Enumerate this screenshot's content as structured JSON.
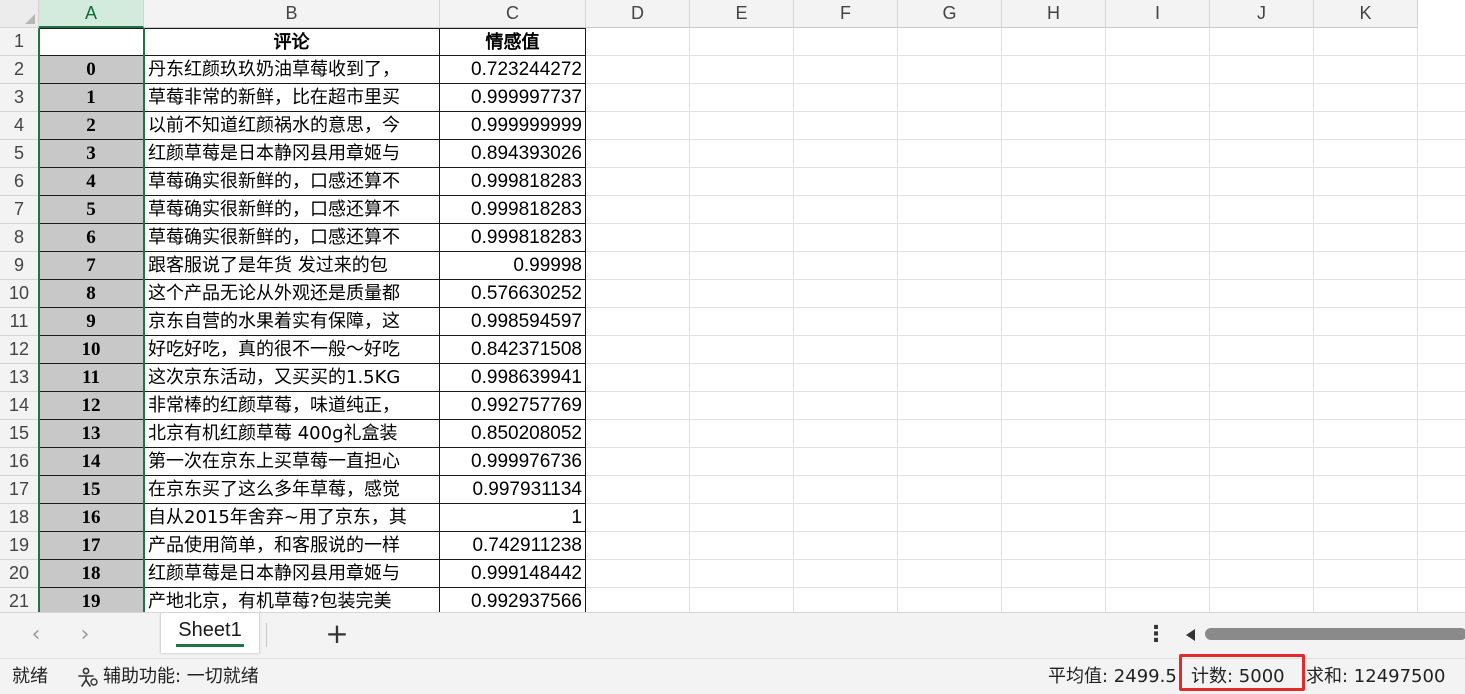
{
  "columns": [
    "A",
    "B",
    "C",
    "D",
    "E",
    "F",
    "G",
    "H",
    "I",
    "J",
    "K"
  ],
  "header_row": {
    "a": "",
    "b": "评论",
    "c": "情感值"
  },
  "rows": [
    {
      "num": "1"
    },
    {
      "num": "2",
      "a": "0",
      "b": "丹东红颜玖玖奶油草莓收到了，",
      "c": "0.723244272"
    },
    {
      "num": "3",
      "a": "1",
      "b": "草莓非常的新鲜，比在超市里买",
      "c": "0.999997737"
    },
    {
      "num": "4",
      "a": "2",
      "b": "以前不知道红颜祸水的意思，今",
      "c": "0.999999999"
    },
    {
      "num": "5",
      "a": "3",
      "b": "红颜草莓是日本静冈县用章姬与",
      "c": "0.894393026"
    },
    {
      "num": "6",
      "a": "4",
      "b": "草莓确实很新鲜的，口感还算不",
      "c": "0.999818283"
    },
    {
      "num": "7",
      "a": "5",
      "b": "草莓确实很新鲜的，口感还算不",
      "c": "0.999818283"
    },
    {
      "num": "8",
      "a": "6",
      "b": "草莓确实很新鲜的，口感还算不",
      "c": "0.999818283"
    },
    {
      "num": "9",
      "a": "7",
      "b": "跟客服说了是年货 发过来的包",
      "c": "0.99998"
    },
    {
      "num": "10",
      "a": "8",
      "b": "这个产品无论从外观还是质量都",
      "c": "0.576630252"
    },
    {
      "num": "11",
      "a": "9",
      "b": "京东自营的水果着实有保障，这",
      "c": "0.998594597"
    },
    {
      "num": "12",
      "a": "10",
      "b": "好吃好吃，真的很不一般～好吃",
      "c": "0.842371508"
    },
    {
      "num": "13",
      "a": "11",
      "b": "这次京东活动，又买买的1.5KG",
      "c": "0.998639941"
    },
    {
      "num": "14",
      "a": "12",
      "b": "非常棒的红颜草莓，味道纯正，",
      "c": "0.992757769"
    },
    {
      "num": "15",
      "a": "13",
      "b": "北京有机红颜草莓 400g礼盒装",
      "c": "0.850208052"
    },
    {
      "num": "16",
      "a": "14",
      "b": "第一次在京东上买草莓一直担心",
      "c": "0.999976736"
    },
    {
      "num": "17",
      "a": "15",
      "b": "在京东买了这么多年草莓，感觉",
      "c": "0.997931134"
    },
    {
      "num": "18",
      "a": "16",
      "b": "自从2015年舍弃~用了京东，其",
      "c": "1"
    },
    {
      "num": "19",
      "a": "17",
      "b": "产品使用简单，和客服说的一样",
      "c": "0.742911238"
    },
    {
      "num": "20",
      "a": "18",
      "b": "红颜草莓是日本静冈县用章姬与",
      "c": "0.999148442"
    },
    {
      "num": "21",
      "a": "19",
      "b": "产地北京，有机草莓?包装完美",
      "c": "0.992937566"
    }
  ],
  "tabs": {
    "nav_prev": "‹",
    "nav_next": "›",
    "sheet_name": "Sheet1",
    "add_label": "+",
    "more_label": "⋮"
  },
  "status": {
    "ready": "就绪",
    "accessibility": "辅助功能: 一切就绪",
    "average": "平均值: 2499.5",
    "count": "计数: 5000",
    "sum": "求和: 12497500"
  },
  "colors": {
    "accent": "#217346",
    "highlight_box": "#e12b2b",
    "selected_fill": "#c8c8c8"
  },
  "icons": {
    "accessibility": "accessibility-person-icon",
    "scroll_left": "scroll-left-arrow-icon"
  }
}
